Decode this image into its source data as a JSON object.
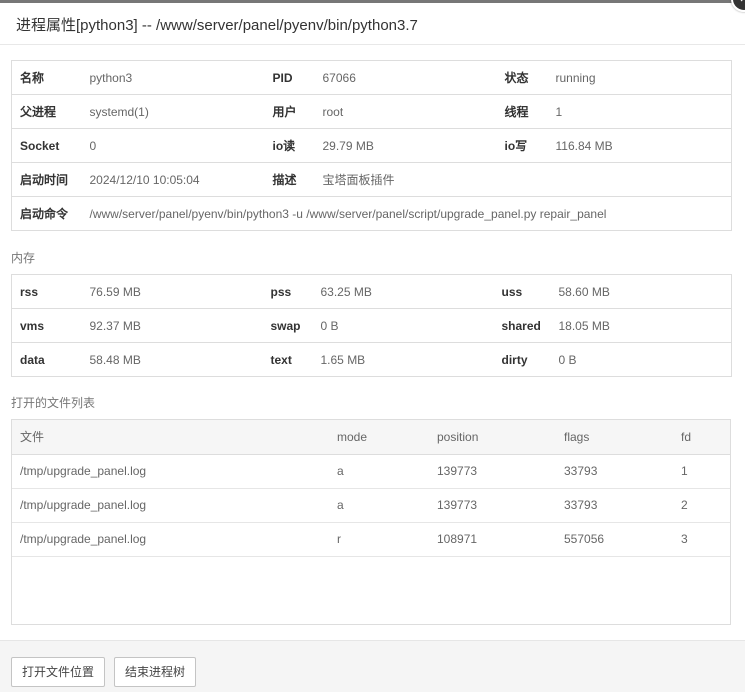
{
  "title": "进程属性[python3] -- /www/server/panel/pyenv/bin/python3.7",
  "close_icon": "×",
  "info": {
    "name_label": "名称",
    "name": "python3",
    "pid_label": "PID",
    "pid": "67066",
    "status_label": "状态",
    "status": "running",
    "ppid_label": "父进程",
    "ppid": "systemd(1)",
    "user_label": "用户",
    "user": "root",
    "threads_label": "线程",
    "threads": "1",
    "socket_label": "Socket",
    "socket": "0",
    "io_read_label": "io读",
    "io_read": "29.79 MB",
    "io_write_label": "io写",
    "io_write": "116.84 MB",
    "start_time_label": "启动时间",
    "start_time": "2024/12/10 10:05:04",
    "desc_label": "描述",
    "desc": "宝塔面板插件",
    "cmd_label": "启动命令",
    "cmd": "/www/server/panel/pyenv/bin/python3 -u /www/server/panel/script/upgrade_panel.py repair_panel"
  },
  "memory": {
    "title": "内存",
    "rss_label": "rss",
    "rss": "76.59 MB",
    "pss_label": "pss",
    "pss": "63.25 MB",
    "uss_label": "uss",
    "uss": "58.60 MB",
    "vms_label": "vms",
    "vms": "92.37 MB",
    "swap_label": "swap",
    "swap": "0 B",
    "shared_label": "shared",
    "shared": "18.05 MB",
    "data_label": "data",
    "data": "58.48 MB",
    "text_label": "text",
    "text": "1.65 MB",
    "dirty_label": "dirty",
    "dirty": "0 B"
  },
  "files": {
    "title": "打开的文件列表",
    "headers": [
      "文件",
      "mode",
      "position",
      "flags",
      "fd"
    ],
    "rows": [
      [
        "/tmp/upgrade_panel.log",
        "a",
        "139773",
        "33793",
        "1"
      ],
      [
        "/tmp/upgrade_panel.log",
        "a",
        "139773",
        "33793",
        "2"
      ],
      [
        "/tmp/upgrade_panel.log",
        "r",
        "108971",
        "557056",
        "3"
      ]
    ]
  },
  "footer": {
    "open_location_label": "打开文件位置",
    "kill_tree_label": "结束进程树"
  }
}
